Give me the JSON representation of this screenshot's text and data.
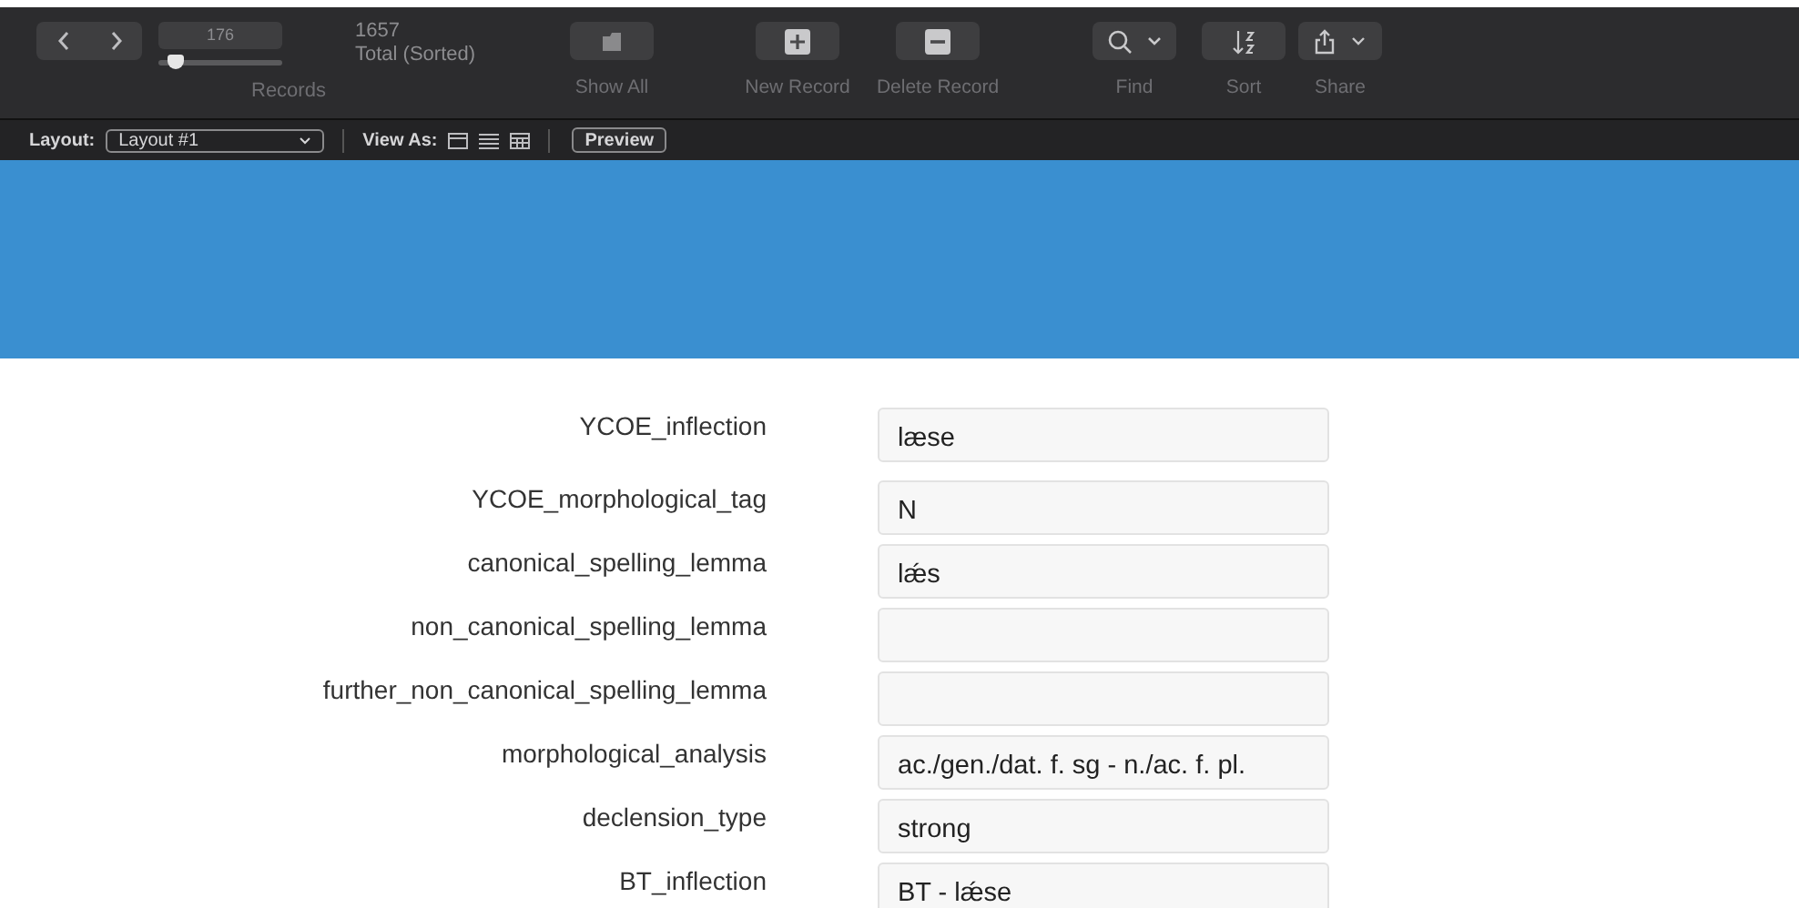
{
  "toolbar": {
    "record_number": "176",
    "record_slider": {
      "level": 0.13
    },
    "records_label": "Records",
    "found_count": "1657",
    "found_status": "Total (Sorted)",
    "buttons": [
      {
        "kind": "show_all",
        "label": "Show All"
      },
      {
        "kind": "new",
        "label": "New Record"
      },
      {
        "kind": "delete",
        "label": "Delete Record"
      },
      {
        "kind": "find",
        "label": "Find"
      },
      {
        "kind": "sort",
        "label": "Sort"
      },
      {
        "kind": "share",
        "label": "Share"
      }
    ]
  },
  "layout_bar": {
    "layout_label": "Layout:",
    "layout_value": "Layout #1",
    "view_as_label": "View As:",
    "preview_button": "Preview"
  },
  "fields": [
    {
      "label": "YCOE_inflection",
      "value": "læse"
    },
    {
      "label": "YCOE_morphological_tag",
      "value": "N"
    },
    {
      "label": "canonical_spelling_lemma",
      "value": "lǽs"
    },
    {
      "label": "non_canonical_spelling_lemma"
    },
    {
      "label": "further_non_canonical_spelling_lemma"
    },
    {
      "label": "morphological_analysis",
      "value": "ac./gen./dat. f. sg - n./ac. f. pl."
    },
    {
      "label": "declension_type",
      "value": "strong"
    },
    {
      "label": "BT_inflection",
      "value": "BT - lǽse"
    }
  ]
}
